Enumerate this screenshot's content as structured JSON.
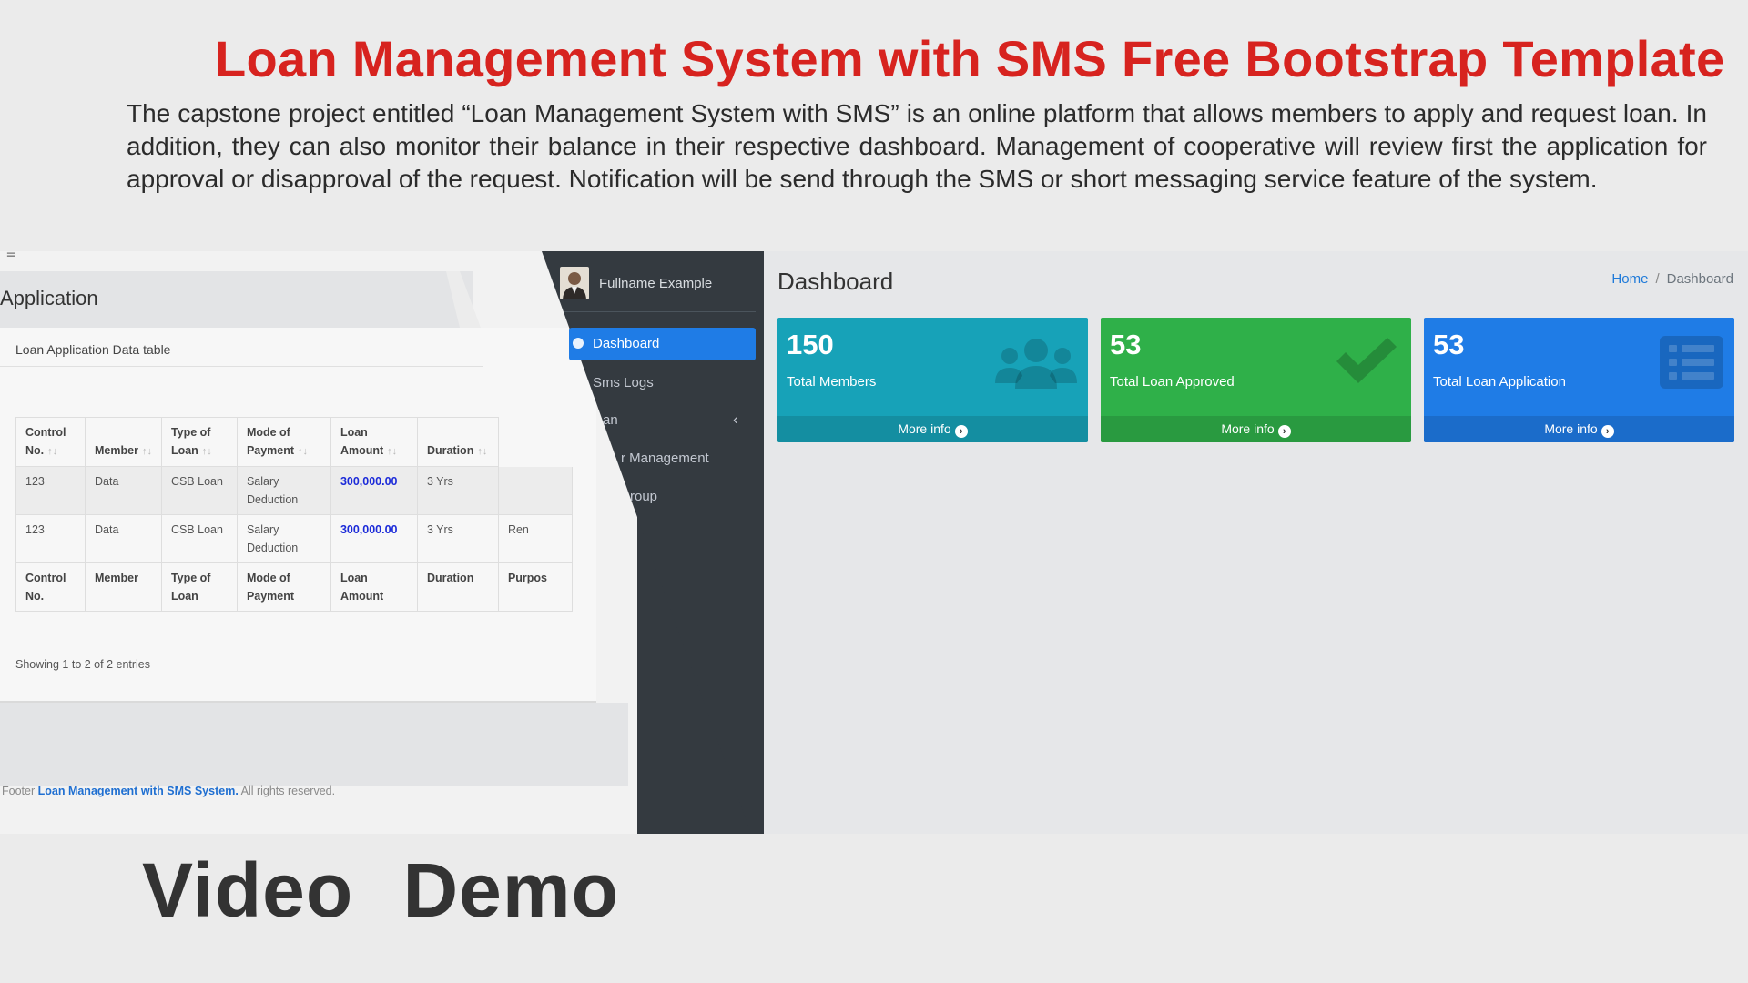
{
  "headline": "Loan Management System with SMS Free Bootstrap Template",
  "intro": "The capstone project entitled “Loan Management System with SMS” is an online platform that allows members to apply and request loan. In addition, they can also monitor their balance in their respective dashboard. Management of cooperative will review first the application for approval or disapproval of the request. Notification will be send through the SMS or short messaging service feature of the system.",
  "video_demo": "Video  Demo",
  "left_panel": {
    "hamburger": "≡",
    "title": "Application",
    "card_title": "Loan Application Data table",
    "table": {
      "headers": [
        {
          "l1": "Control",
          "l2": "No."
        },
        {
          "l1": "",
          "l2": "Member"
        },
        {
          "l1": "Type of",
          "l2": "Loan"
        },
        {
          "l1": "Mode of",
          "l2": "Payment"
        },
        {
          "l1": "Loan",
          "l2": "Amount"
        },
        {
          "l1": "",
          "l2": "Duration"
        }
      ],
      "rows": [
        {
          "control": "123",
          "member": "Data",
          "type": "CSB Loan",
          "mode_l1": "Salary",
          "mode_l2": "Deduction",
          "amount": "300,000.00",
          "duration": "3 Yrs",
          "extra": ""
        },
        {
          "control": "123",
          "member": "Data",
          "type": "CSB Loan",
          "mode_l1": "Salary",
          "mode_l2": "Deduction",
          "amount": "300,000.00",
          "duration": "3 Yrs",
          "extra": "Ren"
        }
      ],
      "footer": [
        {
          "l1": "Control",
          "l2": "No."
        },
        {
          "l1": "Member",
          "l2": ""
        },
        {
          "l1": "Type of",
          "l2": "Loan"
        },
        {
          "l1": "Mode of",
          "l2": "Payment"
        },
        {
          "l1": "Loan",
          "l2": "Amount"
        },
        {
          "l1": "Duration",
          "l2": ""
        },
        {
          "l1": "Purpos",
          "l2": ""
        }
      ]
    },
    "showing": "Showing 1 to 2 of 2 entries",
    "footer": {
      "prefix": "Footer ",
      "brand": "Loan Management with SMS System.",
      "suffix": " All rights reserved."
    }
  },
  "sidebar": {
    "user_name": "Fullname Example",
    "items": [
      {
        "label": "Dashboard",
        "active": true
      },
      {
        "label": "Sms Logs"
      },
      {
        "label": "an"
      },
      {
        "label": "r Management"
      },
      {
        "label": "roup"
      }
    ],
    "chevron": "‹"
  },
  "dashboard": {
    "title": "Dashboard",
    "breadcrumb": {
      "home": "Home",
      "separator": "/",
      "current": "Dashboard"
    },
    "boxes": [
      {
        "value": "150",
        "label": "Total Members",
        "more": "More info",
        "color": "#17a2b8",
        "icon": "users-icon"
      },
      {
        "value": "53",
        "label": "Total Loan Approved",
        "more": "More info",
        "color": "#28a745",
        "icon": "check-icon"
      },
      {
        "value": "53",
        "label": "Total Loan Application",
        "more": "More info",
        "color": "#1f7ce6",
        "icon": "list-icon"
      }
    ]
  },
  "colors": {
    "headline": "#d7231f",
    "sidebar_bg": "#343a40",
    "active_nav": "#1f7ce6",
    "amount": "#1c2bd9"
  }
}
